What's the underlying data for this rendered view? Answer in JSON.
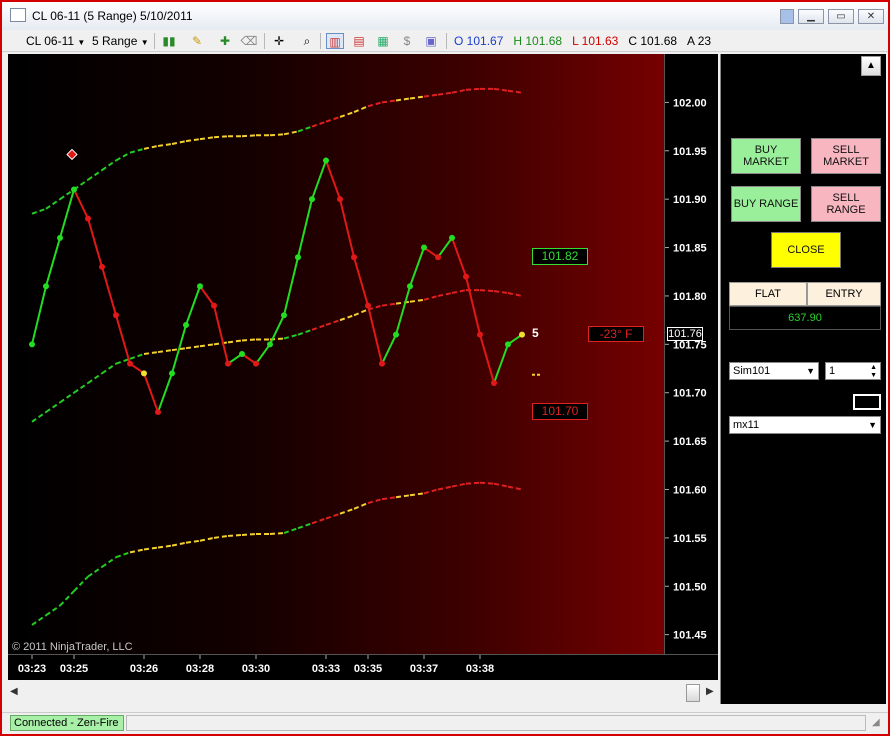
{
  "window": {
    "title": "CL 06-11 (5 Range)  5/10/2011",
    "controls": [
      "▁",
      "▭",
      "✕"
    ]
  },
  "toolbar": {
    "instrument": "CL 06-11",
    "interval": "5 Range",
    "ohlc": [
      {
        "label": "O",
        "value": "101.67",
        "color": "#1a3ecf"
      },
      {
        "label": "H",
        "value": "101.68",
        "color": "#1a8a1a"
      },
      {
        "label": "L",
        "value": "101.63",
        "color": "#d00000"
      },
      {
        "label": "C",
        "value": "101.68",
        "color": "#000000"
      },
      {
        "label": "A",
        "value": "23",
        "color": "#000000"
      }
    ]
  },
  "chart": {
    "copyright": "© 2011 NinjaTrader, LLC",
    "current_price": "101.76",
    "upper_label": "101.82",
    "lower_label": "101.70",
    "angle_label": "-23°  F",
    "count_label": "5",
    "upper_color": "#33dd33",
    "lower_color": "#dd2222"
  },
  "chart_data": {
    "type": "line",
    "ylim": [
      101.43,
      102.05
    ],
    "ticks_y": [
      "102.00",
      "101.95",
      "101.90",
      "101.85",
      "101.80",
      "101.75",
      "101.70",
      "101.65",
      "101.60",
      "101.55",
      "101.50",
      "101.45"
    ],
    "ticks_y_values": [
      102.0,
      101.95,
      101.9,
      101.85,
      101.8,
      101.75,
      101.7,
      101.65,
      101.6,
      101.55,
      101.5,
      101.45
    ],
    "x_labels": [
      "03:23",
      "03:25",
      "03:26",
      "03:28",
      "03:30",
      "03:33",
      "03:35",
      "03:37",
      "03:38"
    ],
    "x_label_index": [
      0,
      3,
      8,
      12,
      16,
      21,
      24,
      28,
      32
    ],
    "price": [
      101.75,
      101.81,
      101.86,
      101.91,
      101.88,
      101.83,
      101.78,
      101.73,
      101.72,
      101.68,
      101.72,
      101.77,
      101.81,
      101.79,
      101.73,
      101.74,
      101.73,
      101.75,
      101.78,
      101.84,
      101.9,
      101.94,
      101.9,
      101.84,
      101.79,
      101.73,
      101.76,
      101.81,
      101.85,
      101.84,
      101.86,
      101.82,
      101.76,
      101.71,
      101.75,
      101.76
    ],
    "price_colors": [
      "g",
      "g",
      "g",
      "g",
      "r",
      "r",
      "r",
      "r",
      "y",
      "r",
      "g",
      "g",
      "g",
      "r",
      "r",
      "g",
      "r",
      "g",
      "g",
      "g",
      "g",
      "g",
      "r",
      "r",
      "r",
      "r",
      "g",
      "g",
      "g",
      "r",
      "g",
      "r",
      "r",
      "r",
      "g",
      "y"
    ],
    "middle_band": [
      101.67,
      101.68,
      101.69,
      101.7,
      101.71,
      101.72,
      101.73,
      101.735,
      101.74,
      101.742,
      101.744,
      101.746,
      101.748,
      101.75,
      101.752,
      101.754,
      101.755,
      101.755,
      101.756,
      101.76,
      101.765,
      101.77,
      101.775,
      101.78,
      101.786,
      101.79,
      101.792,
      101.794,
      101.796,
      101.8,
      101.803,
      101.806,
      101.806,
      101.805,
      101.803,
      101.8
    ],
    "upper_band": [
      101.885,
      101.89,
      101.9,
      101.91,
      101.92,
      101.93,
      101.94,
      101.948,
      101.952,
      101.955,
      101.957,
      101.96,
      101.962,
      101.964,
      101.965,
      101.965,
      101.966,
      101.966,
      101.967,
      101.97,
      101.975,
      101.98,
      101.985,
      101.99,
      101.996,
      102.0,
      102.002,
      102.004,
      102.006,
      102.008,
      102.01,
      102.013,
      102.014,
      102.014,
      102.012,
      102.01
    ],
    "lower_band": [
      101.46,
      101.47,
      101.48,
      101.495,
      101.51,
      101.52,
      101.53,
      101.535,
      101.538,
      101.54,
      101.542,
      101.545,
      101.547,
      101.55,
      101.552,
      101.553,
      101.554,
      101.554,
      101.555,
      101.56,
      101.565,
      101.57,
      101.575,
      101.58,
      101.586,
      101.59,
      101.592,
      101.594,
      101.596,
      101.6,
      101.603,
      101.606,
      101.607,
      101.606,
      101.603,
      101.6
    ],
    "marker_diamond": {
      "index": 3,
      "value": 101.94
    },
    "markers_dash": [
      {
        "index": 36,
        "value": 101.82
      },
      {
        "index": 36,
        "value": 101.7
      }
    ]
  },
  "trade_panel": {
    "buy_market": "BUY MARKET",
    "sell_market": "SELL MARKET",
    "buy_range": "BUY RANGE",
    "sell_range": "SELL RANGE",
    "close": "CLOSE",
    "position_headers": [
      "FLAT",
      "ENTRY"
    ],
    "pnl": "637.90",
    "account": "Sim101",
    "quantity": "1",
    "strategy": "mx11"
  },
  "status": {
    "connection": "Connected - Zen-Fire"
  }
}
